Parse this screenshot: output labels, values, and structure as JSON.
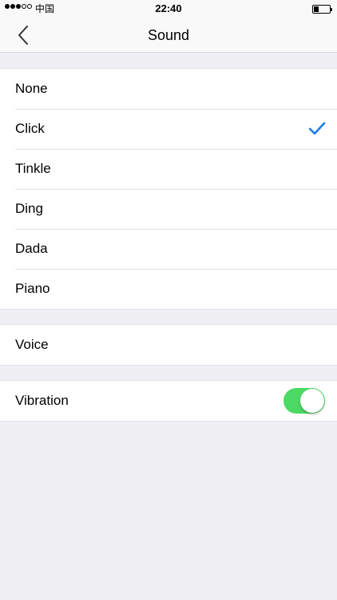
{
  "status_bar": {
    "carrier": "中国",
    "time": "22:40",
    "signal_bars_filled": 3,
    "signal_bars_total": 5,
    "battery_level": 0.3
  },
  "nav": {
    "back_icon": "chevron-left-icon",
    "title": "Sound"
  },
  "sounds": {
    "items": [
      {
        "label": "None"
      },
      {
        "label": "Click",
        "selected": true
      },
      {
        "label": "Tinkle"
      },
      {
        "label": "Ding"
      },
      {
        "label": "Dada"
      },
      {
        "label": "Piano"
      }
    ],
    "check_icon": "checkmark-icon",
    "check_color": "#1a7cf5"
  },
  "voice": {
    "label": "Voice"
  },
  "vibration": {
    "label": "Vibration",
    "enabled": true,
    "switch_color": "#4cd964"
  }
}
